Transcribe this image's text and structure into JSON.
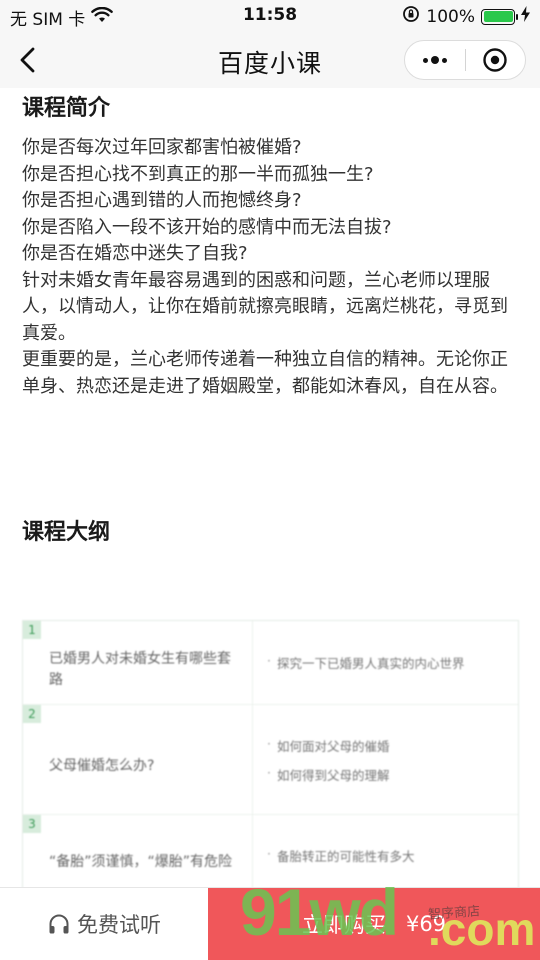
{
  "status_bar": {
    "carrier": "无 SIM 卡",
    "time": "11:58",
    "battery_text": "100%",
    "battery_level": 1.0,
    "battery_color": "#2ac84b"
  },
  "nav": {
    "title": "百度小课"
  },
  "intro": {
    "title": "课程简介",
    "paragraphs": [
      "你是否每次过年回家都害怕被催婚?",
      "你是否担心找不到真正的那一半而孤独一生?",
      "你是否担心遇到错的人而抱憾终身?",
      "你是否陷入一段不该开始的感情中而无法自拔?",
      "你是否在婚恋中迷失了自我?",
      "针对未婚女青年最容易遇到的困惑和问题，兰心老师以理服人，以情动人，让你在婚前就擦亮眼睛，远离烂桃花，寻觅到真爱。",
      "更重要的是，兰心老师传递着一种独立自信的精神。无论你正单身、热恋还是走进了婚姻殿堂，都能如沐春风，自在从容。"
    ]
  },
  "outline": {
    "title": "课程大纲",
    "rows": [
      {
        "num": "1",
        "topic": "已婚男人对未婚女生有哪些套路",
        "points": [
          "探究一下已婚男人真实的内心世界"
        ]
      },
      {
        "num": "2",
        "topic": "父母催婚怎么办?",
        "points": [
          "如何面对父母的催婚",
          "如何得到父母的理解"
        ]
      },
      {
        "num": "3",
        "topic": "“备胎”须谨慎，“爆胎”有危险",
        "points": [
          "备胎转正的可能性有多大"
        ]
      }
    ]
  },
  "bottom_bar": {
    "trial_label": "免费试听",
    "buy_label": "立即购买",
    "price": "¥69",
    "buy_color": "#f0575a"
  },
  "watermark": {
    "brand": "91wd",
    "suffix": ".com",
    "small": "智序商店"
  }
}
